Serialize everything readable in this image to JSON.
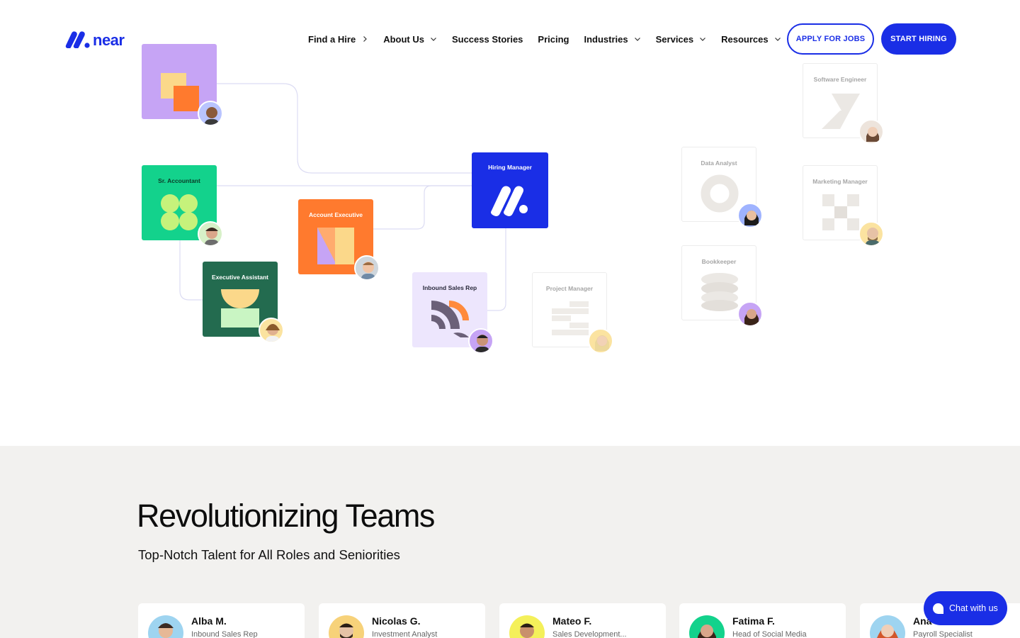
{
  "brand": {
    "name": "near",
    "accent": "#1a2ee6"
  },
  "nav": {
    "items": [
      {
        "label": "Find a Hire",
        "chevron": "right"
      },
      {
        "label": "About Us",
        "chevron": "down"
      },
      {
        "label": "Success Stories",
        "chevron": "none"
      },
      {
        "label": "Pricing",
        "chevron": "none"
      },
      {
        "label": "Industries",
        "chevron": "down"
      },
      {
        "label": "Services",
        "chevron": "down"
      },
      {
        "label": "Resources",
        "chevron": "down"
      }
    ],
    "apply_label": "APPLY FOR JOBS",
    "start_label": "START HIRING"
  },
  "hero": {
    "roles": {
      "top_card": "",
      "sr_accountant": "Sr. Accountant",
      "executive_assistant": "Executive Assistant",
      "account_executive": "Account Executive",
      "inbound_sales_rep": "Inbound Sales Rep",
      "hiring_manager": "Hiring Manager",
      "project_manager": "Project Manager",
      "data_analyst": "Data Analyst",
      "bookkeeper": "Bookkeeper",
      "software_engineer": "Software Engineer",
      "marketing_manager": "Marketing Manager"
    }
  },
  "section": {
    "title": "Revolutionizing Teams",
    "subtitle": "Top-Notch Talent for All Roles and Seniorities",
    "talent": [
      {
        "name": "Alba M.",
        "role": "Inbound Sales Rep"
      },
      {
        "name": "Nicolas G.",
        "role": "Investment Analyst"
      },
      {
        "name": "Mateo F.",
        "role": "Sales Development..."
      },
      {
        "name": "Fatima F.",
        "role": "Head of Social Media"
      },
      {
        "name": "Ana",
        "role": "Payroll Specialist"
      }
    ]
  },
  "chat": {
    "label": "Chat with us"
  }
}
